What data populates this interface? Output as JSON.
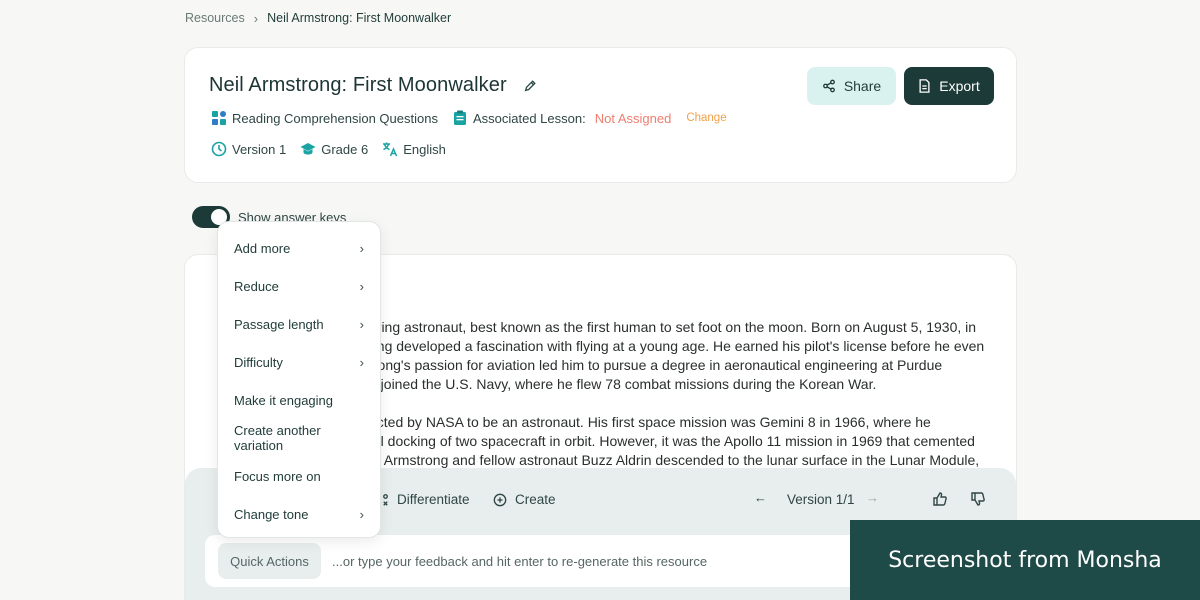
{
  "breadcrumb": {
    "root": "Resources",
    "current": "Neil Armstrong: First Moonwalker"
  },
  "header": {
    "title": "Neil Armstrong: First Moonwalker",
    "resource_type": "Reading Comprehension Questions",
    "associated_lesson_label": "Associated Lesson:",
    "associated_lesson_value": "Not Assigned",
    "change_label": "Change",
    "version": "Version 1",
    "grade": "Grade 6",
    "language": "English",
    "share_label": "Share",
    "export_label": "Export"
  },
  "toggle": {
    "label": "Show answer keys",
    "on": true
  },
  "passage": {
    "para1": [
      "ering astronaut, best known as the first human to set foot on the moon. Born on August 5, 1930, in",
      "ong developed a fascination with flying at a young age. He earned his pilot's license before he even",
      "trong's passion for aviation led him to pursue a degree in aeronautical engineering at Purdue",
      "e joined the U.S. Navy, where he flew 78 combat missions during the Korean War."
    ],
    "para2": [
      "ected by NASA to be an astronaut. His first space mission was Gemini 8 in 1966, where he",
      "ful docking of two spacecraft in orbit. However, it was the Apollo 11 mission in 1969 that cemented",
      "9, Armstrong and fellow astronaut Buzz Aldrin descended to the lunar surface in the Lunar Module,"
    ]
  },
  "menu": {
    "items": [
      {
        "label": "Add more",
        "has_submenu": true
      },
      {
        "label": "Reduce",
        "has_submenu": true
      },
      {
        "label": "Passage length",
        "has_submenu": true
      },
      {
        "label": "Difficulty",
        "has_submenu": true
      },
      {
        "label": "Make it engaging",
        "has_submenu": false
      },
      {
        "label": "Create another variation",
        "has_submenu": false
      },
      {
        "label": "Focus more on",
        "has_submenu": false
      },
      {
        "label": "Change tone",
        "has_submenu": true
      }
    ]
  },
  "toolbar": {
    "differentiate_label": "Differentiate",
    "create_label": "Create",
    "version_label": "Version 1/1"
  },
  "feedback": {
    "quick_actions_label": "Quick Actions",
    "placeholder": "...or type your feedback and hit enter to re-generate this resource"
  },
  "watermark": "Screenshot from Monsha",
  "colors": {
    "primary": "#1c3a37",
    "accent_light": "#d9f2f0",
    "warning": "#ef7d6e",
    "change": "#f0a24b",
    "icon_teal": "#1aa3a3"
  }
}
